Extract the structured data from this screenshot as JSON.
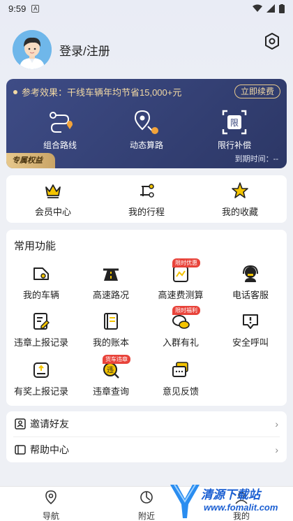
{
  "status_bar": {
    "time": "9:59",
    "notif": "A"
  },
  "profile": {
    "login_label": "登录/注册"
  },
  "vip": {
    "promo": "参考效果：干线车辆年均节省15,000+元",
    "renew": "立即续费",
    "features": [
      {
        "label": "组合路线",
        "icon": "route-icon"
      },
      {
        "label": "动态算路",
        "icon": "dynamic-route-icon"
      },
      {
        "label": "限行补偿",
        "icon": "restriction-icon"
      }
    ],
    "tag": "专属权益",
    "expire": "到期时间：--",
    "colors": {
      "card": "#36437a",
      "gold": "#f2d9a4"
    }
  },
  "quick": [
    {
      "label": "会员中心",
      "icon": "crown-icon"
    },
    {
      "label": "我的行程",
      "icon": "trip-icon"
    },
    {
      "label": "我的收藏",
      "icon": "star-icon"
    }
  ],
  "functions": {
    "title": "常用功能",
    "items": [
      {
        "label": "我的车辆",
        "icon": "vehicle-icon"
      },
      {
        "label": "高速路况",
        "icon": "highway-icon"
      },
      {
        "label": "高速费测算",
        "icon": "toll-icon",
        "badge": "限时优惠"
      },
      {
        "label": "电话客服",
        "icon": "headset-icon"
      },
      {
        "label": "违章上报记录",
        "icon": "edit-doc-icon"
      },
      {
        "label": "我的账本",
        "icon": "ledger-icon"
      },
      {
        "label": "入群有礼",
        "icon": "chat-group-icon",
        "badge": "限时福利"
      },
      {
        "label": "安全呼叫",
        "icon": "alert-icon"
      },
      {
        "label": "有奖上报记录",
        "icon": "upload-icon"
      },
      {
        "label": "违章查询",
        "icon": "violation-search-icon",
        "badge": "货车违章"
      },
      {
        "label": "意见反馈",
        "icon": "feedback-icon"
      }
    ]
  },
  "links": [
    {
      "label": "邀请好友",
      "icon": "invite-icon"
    },
    {
      "label": "帮助中心",
      "icon": "help-icon"
    }
  ],
  "tabs": [
    {
      "label": "导航",
      "icon": "location-pin-icon"
    },
    {
      "label": "附近",
      "icon": "nearby-icon"
    },
    {
      "label": "我的",
      "icon": "me-icon"
    }
  ],
  "watermark": {
    "title": "清源下载站",
    "url": "www.fomalit.com"
  }
}
